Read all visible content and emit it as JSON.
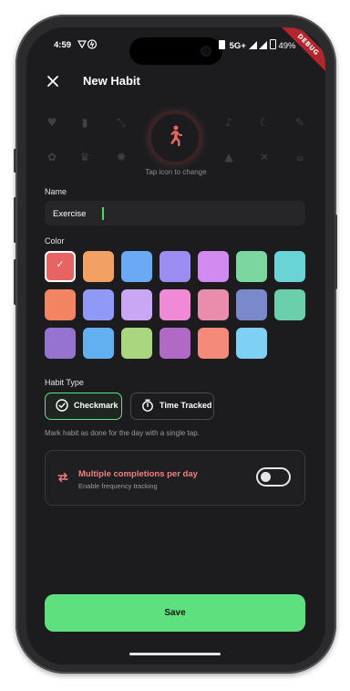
{
  "status_bar": {
    "time": "4:59",
    "network": "5G+",
    "battery": "49%",
    "debug_label": "DEBUG"
  },
  "header": {
    "title": "New Habit",
    "close_icon": "close-icon"
  },
  "icon_picker": {
    "selected_icon": "running-person-icon",
    "selected_color": "#e86464",
    "hint": "Tap icon to change",
    "background_icons": [
      "heart-icon",
      "book-icon",
      "expand-icon",
      "music-note-icon",
      "moon-icon",
      "brush-icon",
      "paw-icon",
      "crown-icon",
      "settings-icon",
      "landscape-icon",
      "yoga-icon",
      "tools-icon",
      "cup-icon"
    ]
  },
  "name_section": {
    "label": "Name",
    "value": "Exercise",
    "placeholder": ""
  },
  "color_section": {
    "label": "Color",
    "colors": [
      "#e86464",
      "#f2a064",
      "#6aaaf5",
      "#9b8df2",
      "#d08af0",
      "#7bd6a0",
      "#6ad3d6",
      "#f28461",
      "#8e9af5",
      "#c9a7f5",
      "#f08ad6",
      "#ea8cac",
      "#7a88cc",
      "#6ad0ac",
      "#9474d0",
      "#62b0f0",
      "#aad680",
      "#b06ac6",
      "#f48a7a",
      "#7ed0f5"
    ],
    "selected_index": 0
  },
  "habit_type": {
    "label": "Habit Type",
    "options": [
      {
        "label": "Checkmark",
        "icon": "check-circle-icon",
        "active": true
      },
      {
        "label": "Time Tracked",
        "icon": "stopwatch-icon",
        "active": false
      }
    ],
    "description": "Mark habit as done for the day with a single tap."
  },
  "multiple_completions": {
    "icon": "repeat-icon",
    "title": "Multiple completions per day",
    "subtitle": "Enable frequency tracking",
    "enabled": false
  },
  "footer": {
    "save_label": "Save"
  }
}
